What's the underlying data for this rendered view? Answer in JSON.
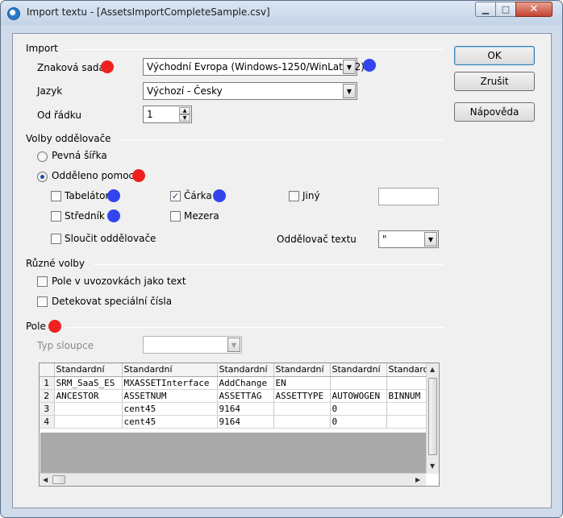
{
  "window": {
    "title": "Import textu - [AssetsImportCompleteSample.csv]"
  },
  "buttons": {
    "ok": "OK",
    "cancel": "Zrušit",
    "help": "Nápověda"
  },
  "import": {
    "section": "Import",
    "charset_label": "Znaková sada",
    "charset_value": "Východní Evropa (Windows-1250/WinLatin 2)",
    "language_label": "Jazyk",
    "language_value": "Výchozí - Česky",
    "from_row_label": "Od řádku",
    "from_row_value": "1"
  },
  "separator": {
    "section": "Volby oddělovače",
    "fixed_width": "Pevná šířka",
    "separated_by": "Odděleno pomocí",
    "tab": "Tabelátor",
    "comma": "Čárka",
    "other": "Jiný",
    "semicolon": "Středník",
    "space": "Mezera",
    "merge": "Sloučit oddělovače",
    "text_delim_label": "Oddělovač textu",
    "text_delim_value": "\"",
    "states": {
      "fixed_width": false,
      "separated_by": true,
      "tab": false,
      "comma": true,
      "other": false,
      "semicolon": false,
      "space": false,
      "merge": false
    }
  },
  "misc": {
    "section": "Různé volby",
    "quoted_as_text": "Pole v uvozovkách jako text",
    "detect_special": "Detekovat speciální čísla"
  },
  "fields": {
    "section": "Pole",
    "column_type_label": "Typ sloupce",
    "column_type_value": ""
  },
  "grid": {
    "headers": [
      "Standardní",
      "Standardní",
      "Standardní",
      "Standardní",
      "Standardní",
      "Standarc"
    ],
    "rows": [
      {
        "num": "1",
        "cells": [
          "SRM_SaaS_ES",
          "MXASSETInterface",
          "AddChange",
          "EN",
          "",
          ""
        ]
      },
      {
        "num": "2",
        "cells": [
          "ANCESTOR",
          "ASSETNUM",
          "ASSETTAG",
          "ASSETTYPE",
          "AUTOWOGEN",
          "BINNUM"
        ]
      },
      {
        "num": "3",
        "cells": [
          "",
          "cent45",
          "9164",
          "",
          "0",
          ""
        ]
      },
      {
        "num": "4",
        "cells": [
          "",
          "cent45",
          "9164",
          "",
          "0",
          ""
        ]
      }
    ]
  },
  "colors": {
    "annotation_red": "#f02020",
    "annotation_blue": "#3344ee",
    "title_bar": "#c9d8ea"
  }
}
